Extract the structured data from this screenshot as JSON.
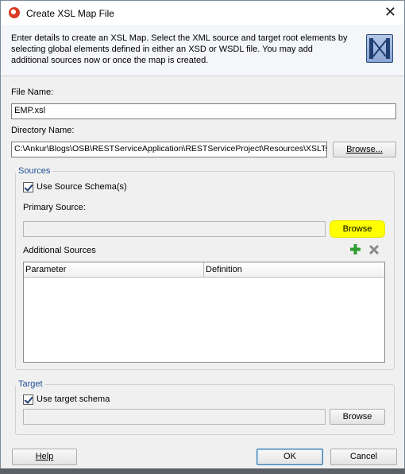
{
  "window": {
    "title": "Create XSL Map File",
    "close_glyph": "✕"
  },
  "description": "Enter details to create an XSL Map. Select the XML source and target root elements by selecting global elements defined in either an XSD or WSDL file.  You may add additional sources now or once the map is created.",
  "file_name": {
    "label": "File Name:",
    "value": "EMP.xsl"
  },
  "directory": {
    "label": "Directory Name:",
    "value": "C:\\Ankur\\Blogs\\OSB\\RESTServiceApplication\\RESTServiceProject\\Resources\\XSLTs",
    "browse_label": "Browse..."
  },
  "sources": {
    "title": "Sources",
    "use_schema_label": "Use Source Schema(s)",
    "use_schema_checked": true,
    "primary_label": "Primary Source:",
    "primary_value": "",
    "browse_label": "Browse",
    "additional_label": "Additional Sources",
    "columns": [
      "Parameter",
      "Definition"
    ],
    "rows": []
  },
  "target": {
    "title": "Target",
    "use_schema_label": "Use target schema",
    "use_schema_checked": true,
    "value": "",
    "browse_label": "Browse"
  },
  "footer": {
    "help_label": "Help",
    "ok_label": "OK",
    "cancel_label": "Cancel"
  },
  "colors": {
    "accent": "#1f4f96",
    "highlight": "#ffff00",
    "add_green": "#2f9e2f"
  }
}
